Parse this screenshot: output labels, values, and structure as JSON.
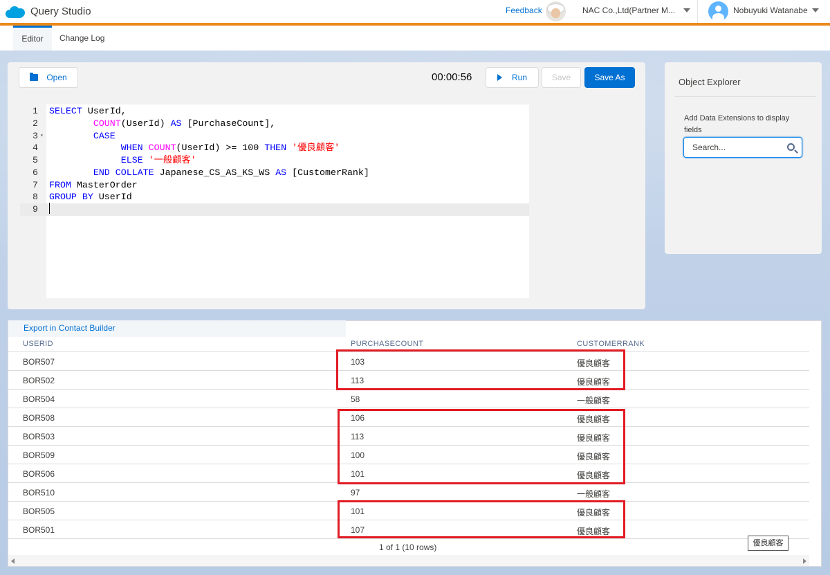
{
  "header": {
    "app_title": "Query Studio",
    "feedback": "Feedback",
    "org": "NAC Co.,Ltd(Partner M...",
    "user": "Nobuyuki Watanabe"
  },
  "tabs": [
    {
      "label": "Editor",
      "active": true
    },
    {
      "label": "Change Log",
      "active": false
    }
  ],
  "toolbar": {
    "open": "Open",
    "timer": "00:00:56",
    "run": "Run",
    "save": "Save",
    "save_as": "Save As"
  },
  "editor": {
    "line_numbers": [
      "1",
      "2",
      "3",
      "4",
      "5",
      "6",
      "7",
      "8",
      "9"
    ]
  },
  "explorer": {
    "title": "Object Explorer",
    "hint": "Add Data Extensions to display fields",
    "search_placeholder": "Search..."
  },
  "results": {
    "export_link": "Export in Contact Builder",
    "columns": [
      "USERID",
      "PURCHASECOUNT",
      "CUSTOMERRANK"
    ],
    "rows": [
      [
        "BOR507",
        "103",
        "優良顧客"
      ],
      [
        "BOR502",
        "113",
        "優良顧客"
      ],
      [
        "BOR504",
        "58",
        "一般顧客"
      ],
      [
        "BOR508",
        "106",
        "優良顧客"
      ],
      [
        "BOR503",
        "113",
        "優良顧客"
      ],
      [
        "BOR509",
        "100",
        "優良顧客"
      ],
      [
        "BOR506",
        "101",
        "優良顧客"
      ],
      [
        "BOR510",
        "97",
        "一般顧客"
      ],
      [
        "BOR505",
        "101",
        "優良顧客"
      ],
      [
        "BOR501",
        "107",
        "優良顧客"
      ]
    ],
    "pager": "1 of 1 (10 rows)",
    "tooltip": "優良顧客"
  },
  "colors": {
    "accent": "#0070d2",
    "header_bar": "#e98a1b",
    "highlight": "#e21b24"
  }
}
